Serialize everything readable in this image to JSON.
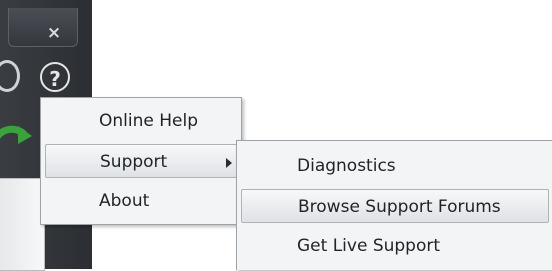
{
  "titlebar": {
    "close_icon": "close-icon",
    "close_glyph": "×"
  },
  "toolbar": {
    "help_icon": "help-icon",
    "help_glyph": "?"
  },
  "main_menu": {
    "items": [
      {
        "label": "Online Help",
        "has_submenu": false,
        "highlighted": false
      },
      {
        "label": "Support",
        "has_submenu": true,
        "highlighted": true
      },
      {
        "label": "About",
        "has_submenu": false,
        "highlighted": false
      }
    ]
  },
  "support_submenu": {
    "items": [
      {
        "label": "Diagnostics",
        "highlighted": false
      },
      {
        "label": "Browse Support Forums",
        "highlighted": true
      },
      {
        "label": "Get Live Support",
        "highlighted": false
      }
    ]
  },
  "colors": {
    "app_background": "#2b2e32",
    "menu_background": "#f3f4f5",
    "refresh_green": "#3aa33c"
  }
}
